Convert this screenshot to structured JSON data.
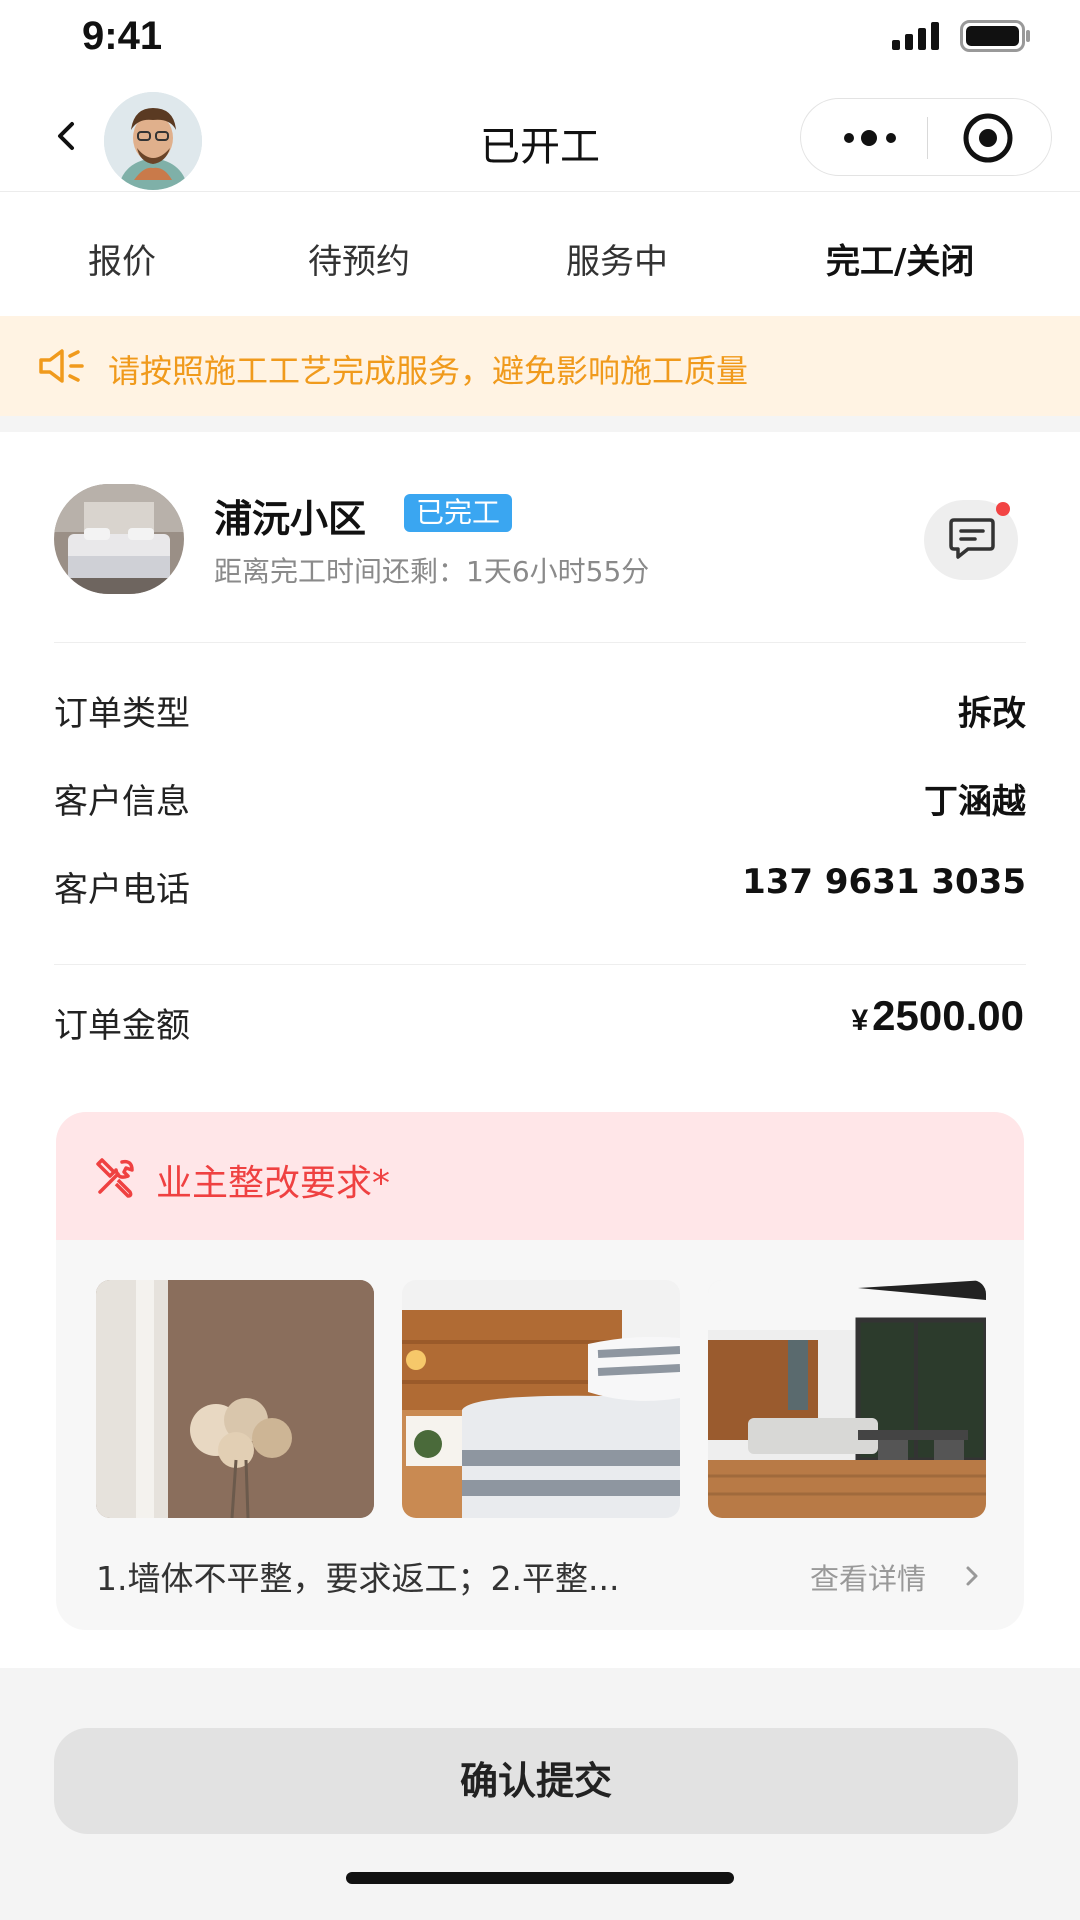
{
  "status_bar": {
    "time": "9:41"
  },
  "nav": {
    "title": "已开工"
  },
  "tabs": [
    {
      "label": "报价"
    },
    {
      "label": "待预约"
    },
    {
      "label": "服务中"
    },
    {
      "label": "完工/关闭",
      "active": true
    }
  ],
  "notice": {
    "text": "请按照施工工艺完成服务，避免影响施工质量",
    "color": "#f09a1c"
  },
  "project": {
    "name": "浦沅小区",
    "badge": "已完工",
    "subtitle": "距离完工时间还剩：1天6小时55分"
  },
  "info": [
    {
      "label": "订单类型",
      "value": "拆改"
    },
    {
      "label": "客户信息",
      "value": "丁涵越"
    },
    {
      "label": "客户电话",
      "value": "137 9631 3035"
    }
  ],
  "amount": {
    "label": "订单金额",
    "currency": "¥",
    "value": "2500.00"
  },
  "requirement": {
    "title": "业主整改要求*",
    "description": "1.墙体不平整，要求返工；2.平整...",
    "detail_link": "查看详情",
    "accent": "#ef4141"
  },
  "submit": {
    "label": "确认提交"
  },
  "icons": {
    "back": "chevron-left-icon",
    "more": "more-dots-icon",
    "close": "target-close-icon",
    "notice": "speaker-icon",
    "chat": "message-icon",
    "requirement": "tools-icon",
    "detail": "chevron-right-icon"
  }
}
